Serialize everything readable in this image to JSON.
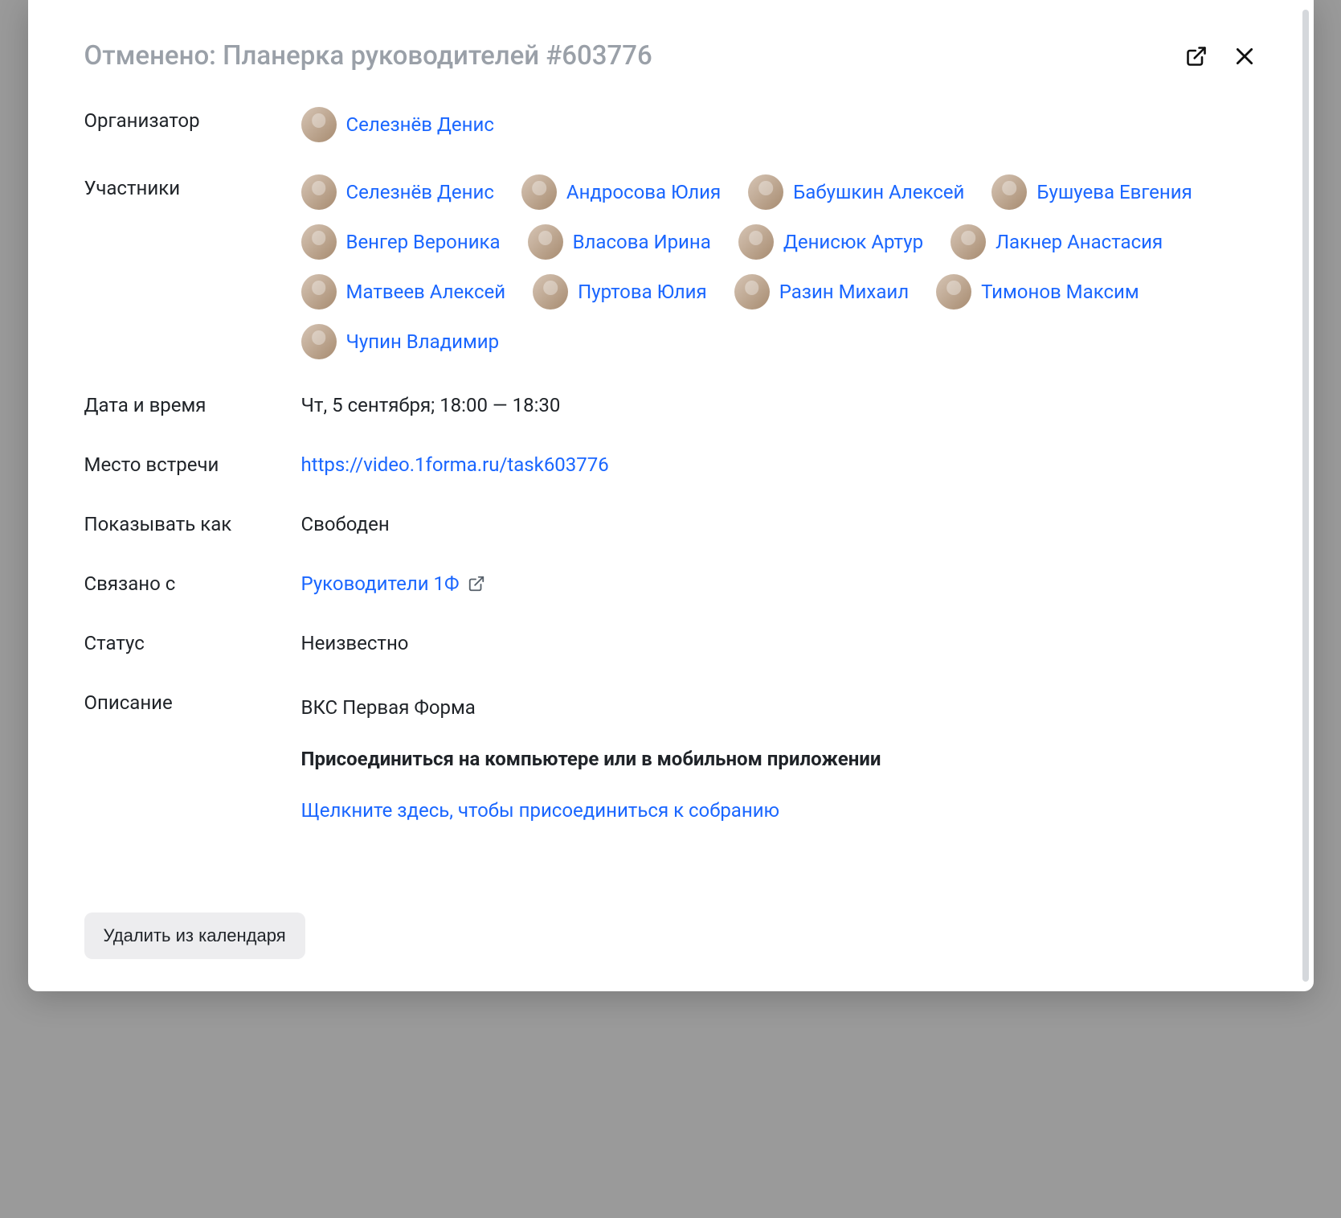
{
  "header": {
    "title": "Отменено: Планерка руководителей #603776"
  },
  "labels": {
    "organizer": "Организатор",
    "participants": "Участники",
    "datetime": "Дата и время",
    "location": "Место встречи",
    "show_as": "Показывать как",
    "related": "Связано с",
    "status": "Статус",
    "description": "Описание"
  },
  "organizer": {
    "name": "Селезнёв Денис"
  },
  "participants": [
    {
      "name": "Селезнёв Денис"
    },
    {
      "name": "Андросова Юлия"
    },
    {
      "name": "Бабушкин Алексей"
    },
    {
      "name": "Бушуева Евгения"
    },
    {
      "name": "Венгер Вероника"
    },
    {
      "name": "Власова Ирина"
    },
    {
      "name": "Денисюк Артур"
    },
    {
      "name": "Лакнер Анастасия"
    },
    {
      "name": "Матвеев Алексей"
    },
    {
      "name": "Пуртова Юлия"
    },
    {
      "name": "Разин Михаил"
    },
    {
      "name": "Тимонов Максим"
    },
    {
      "name": "Чупин Владимир"
    }
  ],
  "datetime": "Чт, 5 сентября; 18:00 — 18:30",
  "location_url": "https://video.1forma.ru/task603776",
  "show_as": "Свободен",
  "related": {
    "label": "Руководители 1Ф"
  },
  "status": "Неизвестно",
  "description": {
    "line1": "ВКС Первая Форма",
    "heading": "Присоединиться на компьютере или в мобильном приложении",
    "join_link": "Щелкните здесь, чтобы присоединиться к собранию"
  },
  "footer": {
    "delete_label": "Удалить из календаря"
  }
}
